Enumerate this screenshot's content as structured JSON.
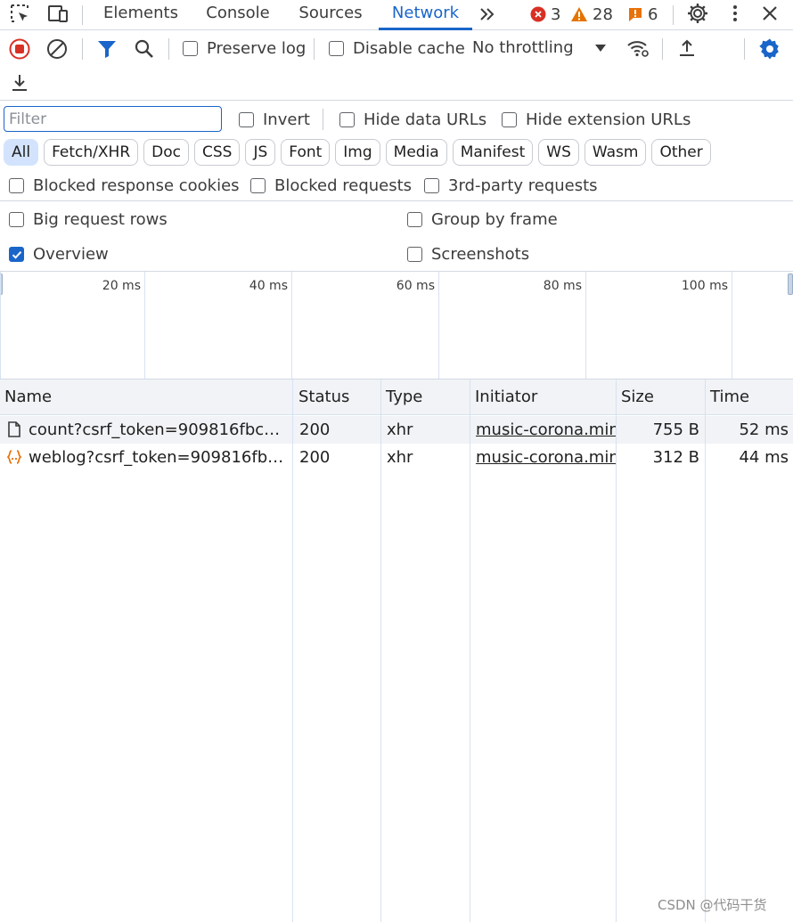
{
  "tabs": [
    {
      "label": "Elements",
      "active": false
    },
    {
      "label": "Console",
      "active": false
    },
    {
      "label": "Sources",
      "active": false
    },
    {
      "label": "Network",
      "active": true
    }
  ],
  "badges": {
    "errors": "3",
    "warnings": "28",
    "issues": "6"
  },
  "toolbar": {
    "preserve_log": "Preserve log",
    "disable_cache": "Disable cache",
    "throttling": "No throttling"
  },
  "filter": {
    "placeholder": "Filter",
    "value": "",
    "invert": "Invert",
    "hide_data_urls": "Hide data URLs",
    "hide_extension_urls": "Hide extension URLs",
    "types": [
      "All",
      "Fetch/XHR",
      "Doc",
      "CSS",
      "JS",
      "Font",
      "Img",
      "Media",
      "Manifest",
      "WS",
      "Wasm",
      "Other"
    ],
    "blocked_response_cookies": "Blocked response cookies",
    "blocked_requests": "Blocked requests",
    "third_party_requests": "3rd-party requests"
  },
  "settings": {
    "big_request_rows": "Big request rows",
    "group_by_frame": "Group by frame",
    "overview": "Overview",
    "overview_checked": true,
    "screenshots": "Screenshots"
  },
  "overview_ticks": [
    "20 ms",
    "40 ms",
    "60 ms",
    "80 ms",
    "100 ms"
  ],
  "table": {
    "columns": [
      "Name",
      "Status",
      "Type",
      "Initiator",
      "Size",
      "Time"
    ],
    "rows": [
      {
        "name": "count?csrf_token=909816fbcc8...",
        "status": "200",
        "type": "xhr",
        "initiator": "music-corona.min.",
        "size": "755 B",
        "time": "52 ms",
        "icon": "document-icon"
      },
      {
        "name": "weblog?csrf_token=909816fbcc...",
        "status": "200",
        "type": "xhr",
        "initiator": "music-corona.min.",
        "size": "312 B",
        "time": "44 ms",
        "icon": "json-brace-icon"
      }
    ]
  },
  "watermark": "CSDN @代码干货",
  "colors": {
    "accent": "#1a65c9",
    "record_stop": "#d93025",
    "warning": "#e37400",
    "error": "#d93025"
  }
}
